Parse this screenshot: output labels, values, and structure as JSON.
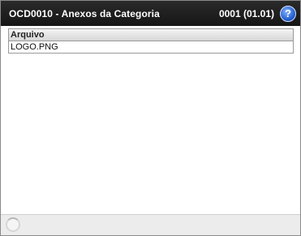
{
  "window": {
    "title": "OCD0010 - Anexos da Categoria",
    "version": "0001 (01.01)",
    "help_label": "?"
  },
  "table": {
    "header": "Arquivo",
    "rows": [
      "LOGO.PNG"
    ]
  },
  "icons": {
    "help": "help-icon",
    "loading": "loading-spinner-icon"
  },
  "colors": {
    "titlebar": "#1e1e1e",
    "help_button": "#1b56c8"
  }
}
